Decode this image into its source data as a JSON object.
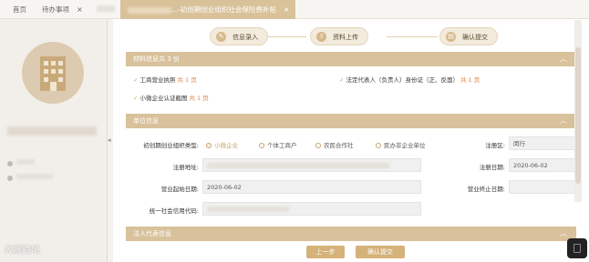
{
  "tabs": {
    "home": "首页",
    "todo": "待办事项",
    "todo_close": "×",
    "active": "...-初创期创业组织社会保险费补贴",
    "active_close": "×"
  },
  "steps": {
    "s1": "信息录入",
    "s2": "资料上传",
    "s3": "确认提交"
  },
  "materials": {
    "title": "材料信息共 3 份",
    "items": [
      {
        "label": "工商营业执照",
        "count": "共 1 页"
      },
      {
        "label": "法定代表人（负责人）身份证（正、反面）",
        "count": "共 1 页"
      },
      {
        "label": "小微企业认证截图",
        "count": "共 1 页"
      }
    ]
  },
  "unit": {
    "title": "单位信息",
    "type_label": "初创期创业组织类型:",
    "types": [
      "小微企业",
      "个体工商户",
      "农民合作社",
      "民办非企业单位"
    ],
    "reg_area_label": "注册区:",
    "reg_area_value": "闵行",
    "address_label": "注册地址:",
    "reg_date_label": "注册日期:",
    "reg_date_value": "2020-06-02",
    "biz_start_label": "营业起始日期:",
    "biz_start_value": "2020-06-02",
    "biz_end_label": "营业终止日期:",
    "credit_label": "统一社会信用代码:"
  },
  "legal": {
    "title": "法人代表信息"
  },
  "buttons": {
    "prev": "上一步",
    "confirm": "确认提交"
  },
  "watermark": "犬猴跨境",
  "chev_up": "︿"
}
